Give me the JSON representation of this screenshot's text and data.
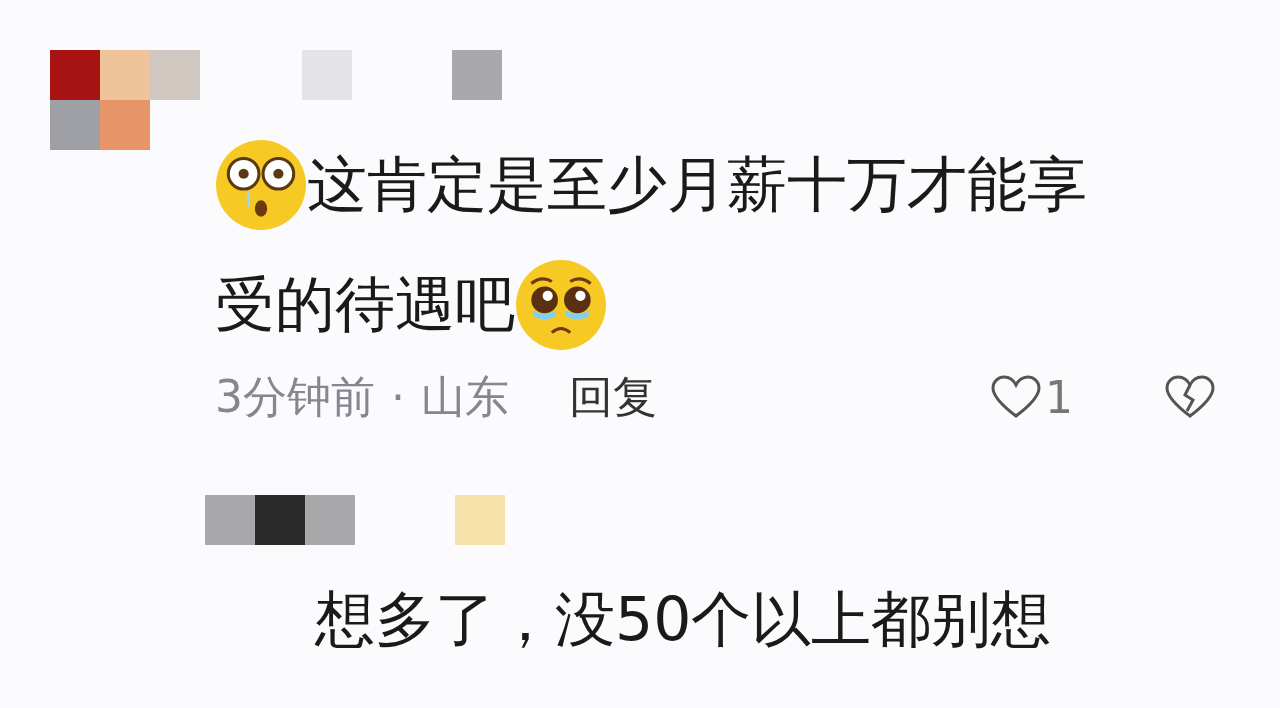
{
  "comments": [
    {
      "kind": "top",
      "lines": [
        [
          {
            "kind": "dazed-emoji"
          },
          {
            "kind": "text",
            "text": "这肯定是至少月薪十万才能享"
          }
        ],
        [
          {
            "kind": "text",
            "text": "受的待遇吧"
          },
          {
            "kind": "pleading-emoji"
          }
        ]
      ],
      "time": "3分钟前",
      "separator": "·",
      "location": "山东",
      "reply_label": "回复",
      "likes": "1"
    },
    {
      "kind": "reply",
      "lines": [
        [
          {
            "kind": "text",
            "text": "想多了，没50个以上都别想"
          }
        ]
      ]
    }
  ]
}
